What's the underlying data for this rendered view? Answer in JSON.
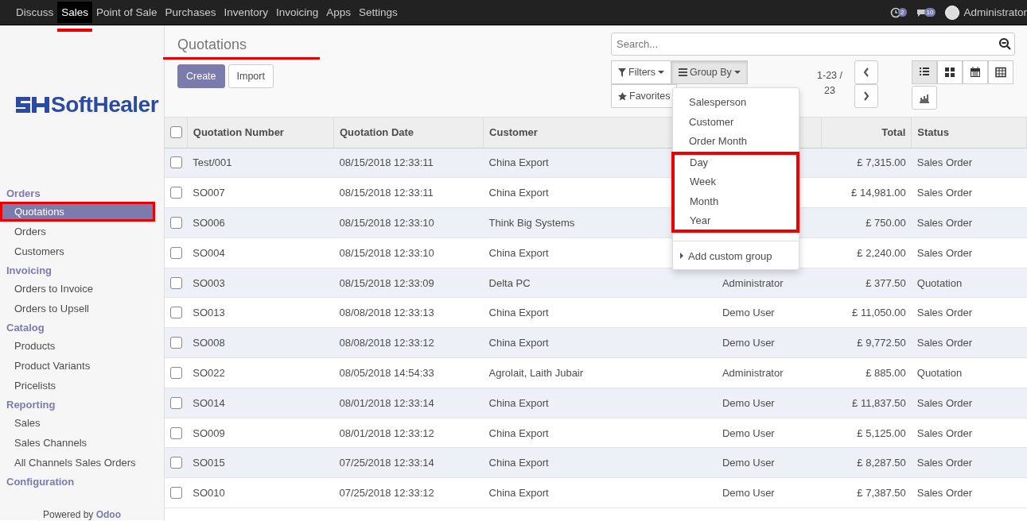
{
  "top_menu": [
    {
      "label": "Discuss",
      "selected": false,
      "highlighted": false
    },
    {
      "label": "Sales",
      "selected": true,
      "highlighted": true
    },
    {
      "label": "Point of Sale",
      "selected": false,
      "highlighted": false
    },
    {
      "label": "Purchases",
      "selected": false,
      "highlighted": false
    },
    {
      "label": "Inventory",
      "selected": false,
      "highlighted": false
    },
    {
      "label": "Invoicing",
      "selected": false,
      "highlighted": false
    },
    {
      "label": "Apps",
      "selected": false,
      "highlighted": false
    },
    {
      "label": "Settings",
      "selected": false,
      "highlighted": false
    }
  ],
  "systray": {
    "activity_count": "2",
    "message_count": "10",
    "user": "Administrator"
  },
  "sidebar": {
    "logo": "SoftHealer",
    "sections": [
      {
        "title": "Orders",
        "items": [
          {
            "label": "Quotations",
            "selected": true,
            "highlighted": true
          },
          {
            "label": "Orders",
            "selected": false,
            "highlighted": false
          },
          {
            "label": "Customers",
            "selected": false,
            "highlighted": false
          }
        ]
      },
      {
        "title": "Invoicing",
        "items": [
          {
            "label": "Orders to Invoice",
            "selected": false,
            "highlighted": false
          },
          {
            "label": "Orders to Upsell",
            "selected": false,
            "highlighted": false
          }
        ]
      },
      {
        "title": "Catalog",
        "items": [
          {
            "label": "Products",
            "selected": false,
            "highlighted": false
          },
          {
            "label": "Product Variants",
            "selected": false,
            "highlighted": false
          },
          {
            "label": "Pricelists",
            "selected": false,
            "highlighted": false
          }
        ]
      },
      {
        "title": "Reporting",
        "items": [
          {
            "label": "Sales",
            "selected": false,
            "highlighted": false
          },
          {
            "label": "Sales Channels",
            "selected": false,
            "highlighted": false
          },
          {
            "label": "All Channels Sales Orders",
            "selected": false,
            "highlighted": false
          }
        ]
      },
      {
        "title": "Configuration"
      }
    ],
    "footer": "Powered by **Odoo**"
  },
  "breadcrumb": {
    "title": "Quotations",
    "highlighted": true
  },
  "buttons": [
    {
      "label": "Create",
      "kind": "primary"
    },
    {
      "label": "Import",
      "kind": "secondary"
    }
  ],
  "search": {
    "placeholder": "Search..."
  },
  "search_options": [
    {
      "label": "Filters",
      "kind": "filter",
      "selected": false
    },
    {
      "label": "Group By",
      "kind": "group",
      "selected": true
    },
    {
      "label": "Favorites",
      "kind": "star",
      "selected": false
    }
  ],
  "pager": "1-23 / 23",
  "views": [
    {
      "kind": "list",
      "selected": true
    },
    {
      "kind": "kanban",
      "selected": false
    },
    {
      "kind": "calendar",
      "selected": false
    },
    {
      "kind": "pivot",
      "selected": false
    },
    {
      "kind": "graph",
      "selected": false
    }
  ],
  "group_by_menu": {
    "groups": [
      {
        "highlighted": false,
        "items": [
          "Salesperson",
          "Customer",
          "Order Month"
        ]
      },
      {
        "highlighted": true,
        "items": [
          "Day",
          "Week",
          "Month",
          "Year"
        ]
      }
    ],
    "custom": "Add custom group"
  },
  "table": {
    "header_checked": false,
    "columns": [
      {
        "label": "Quotation Number",
        "kind": "text"
      },
      {
        "label": "Quotation Date",
        "kind": "text"
      },
      {
        "label": "Customer",
        "kind": "text"
      },
      {
        "kind": "text"
      },
      {
        "label": "Total",
        "kind": "amount"
      },
      {
        "label": "Status",
        "kind": "text"
      }
    ],
    "rows": [
      {
        "checked": false,
        "cells": [
          "Test/001",
          "08/15/2018 12:33:11",
          "China Export",
          null,
          "£ 7,315.00",
          "Sales Order"
        ]
      },
      {
        "checked": false,
        "cells": [
          "SO007",
          "08/15/2018 12:33:11",
          "China Export",
          null,
          "£ 14,981.00",
          "Sales Order"
        ]
      },
      {
        "checked": false,
        "cells": [
          "SO006",
          "08/15/2018 12:33:10",
          "Think Big Systems",
          null,
          "£ 750.00",
          "Sales Order"
        ]
      },
      {
        "checked": false,
        "cells": [
          "SO004",
          "08/15/2018 12:33:10",
          "China Export",
          null,
          "£ 2,240.00",
          "Sales Order"
        ]
      },
      {
        "checked": false,
        "cells": [
          "SO003",
          "08/15/2018 12:33:09",
          "Delta PC",
          "Administrator",
          "£ 377.50",
          "Quotation"
        ]
      },
      {
        "checked": false,
        "cells": [
          "SO013",
          "08/08/2018 12:33:13",
          "China Export",
          "Demo User",
          "£ 11,050.00",
          "Sales Order"
        ]
      },
      {
        "checked": false,
        "cells": [
          "SO008",
          "08/08/2018 12:33:12",
          "China Export",
          "Demo User",
          "£ 9,772.50",
          "Sales Order"
        ]
      },
      {
        "checked": false,
        "cells": [
          "SO022",
          "08/05/2018 14:54:33",
          "Agrolait, Laith Jubair",
          "Administrator",
          "£ 885.00",
          "Quotation"
        ]
      },
      {
        "checked": false,
        "cells": [
          "SO014",
          "08/01/2018 12:33:14",
          "China Export",
          "Demo User",
          "£ 11,837.50",
          "Sales Order"
        ]
      },
      {
        "checked": false,
        "cells": [
          "SO009",
          "08/01/2018 12:33:12",
          "China Export",
          "Demo User",
          "£ 5,125.00",
          "Sales Order"
        ]
      },
      {
        "checked": false,
        "cells": [
          "SO015",
          "07/25/2018 12:33:14",
          "China Export",
          "Demo User",
          "£ 8,287.50",
          "Sales Order"
        ]
      },
      {
        "checked": false,
        "cells": [
          "SO010",
          "07/25/2018 12:33:12",
          "China Export",
          "Demo User",
          "£ 7,387.50",
          "Sales Order"
        ]
      }
    ]
  }
}
